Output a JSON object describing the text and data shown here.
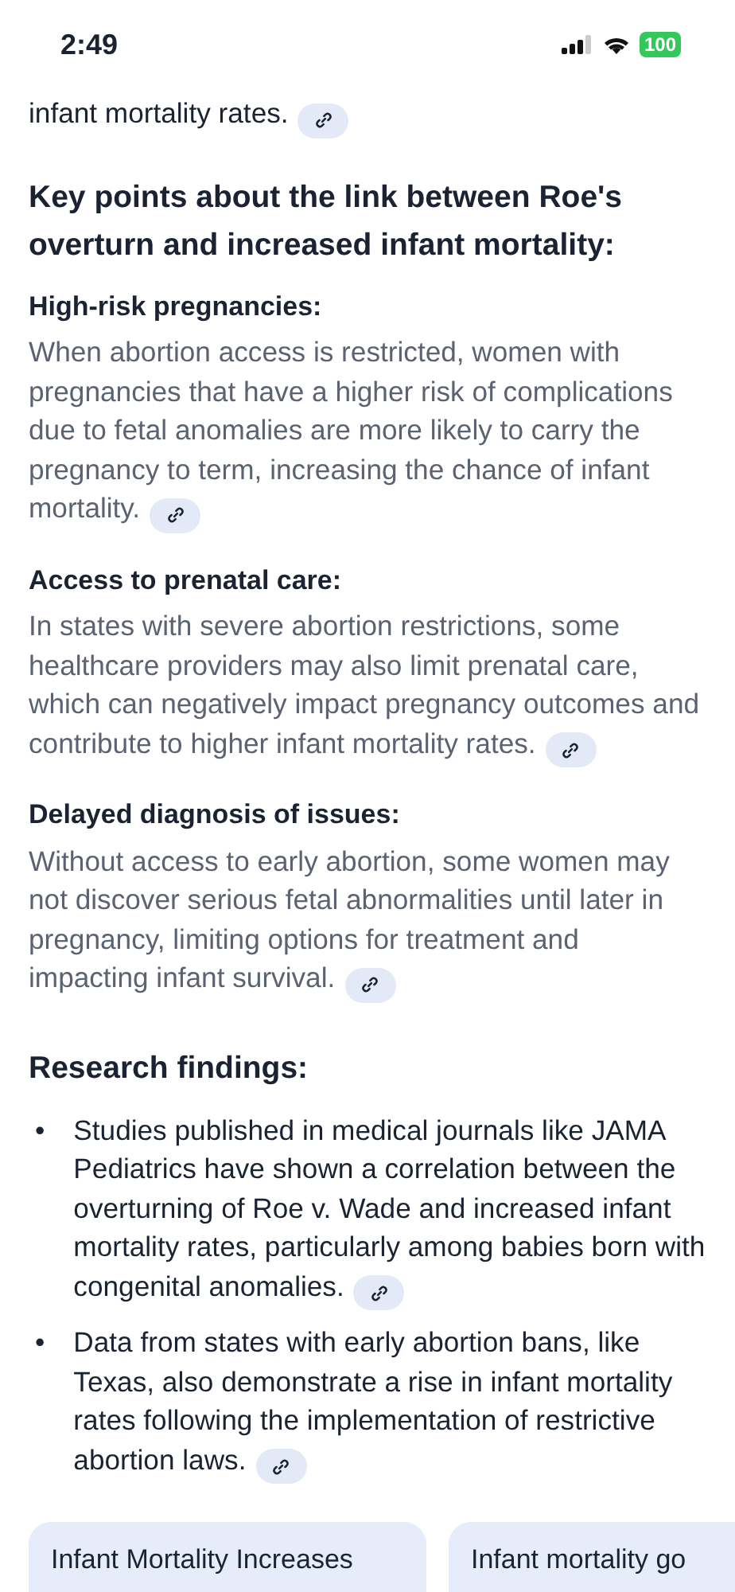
{
  "status_bar": {
    "time": "2:49",
    "battery": "100"
  },
  "intro": {
    "text": "infant mortality rates.",
    "link": true
  },
  "heading": "Key points about the link between Roe's overturn and increased infant mortality:",
  "points": [
    {
      "title": "High-risk pregnancies:",
      "text": "When abortion access is restricted, women with pregnancies that have a higher risk of complications due to fetal anomalies are more likely to carry the pregnancy to term, increasing the chance of infant mortality.",
      "link": true
    },
    {
      "title": "Access to prenatal care:",
      "text": "In states with severe abortion restrictions, some healthcare providers may also limit prenatal care, which can negatively impact pregnancy outcomes and contribute to higher infant mortality rates.",
      "link": true
    },
    {
      "title": "Delayed diagnosis of issues:",
      "text": "Without access to early abortion, some women may not discover serious fetal abnormalities until later in pregnancy, limiting options for treatment and impacting infant survival.",
      "link": true
    }
  ],
  "research": {
    "title": "Research findings:",
    "bullets": [
      {
        "marker": "•",
        "text": "Studies published in medical journals like JAMA Pediatrics have shown a correlation between the overturning of Roe v. Wade and increased infant mortality rates, particularly among babies born with congenital anomalies.",
        "link": true
      },
      {
        "marker": "•",
        "text": "Data from states with early abortion bans, like Texas, also demonstrate a rise in infant mortality rates following the implementation of restrictive abortion laws.",
        "link": true
      }
    ]
  },
  "sources": [
    {
      "title": "Infant Mortality Increases"
    },
    {
      "title": "Infant mortality go"
    }
  ]
}
